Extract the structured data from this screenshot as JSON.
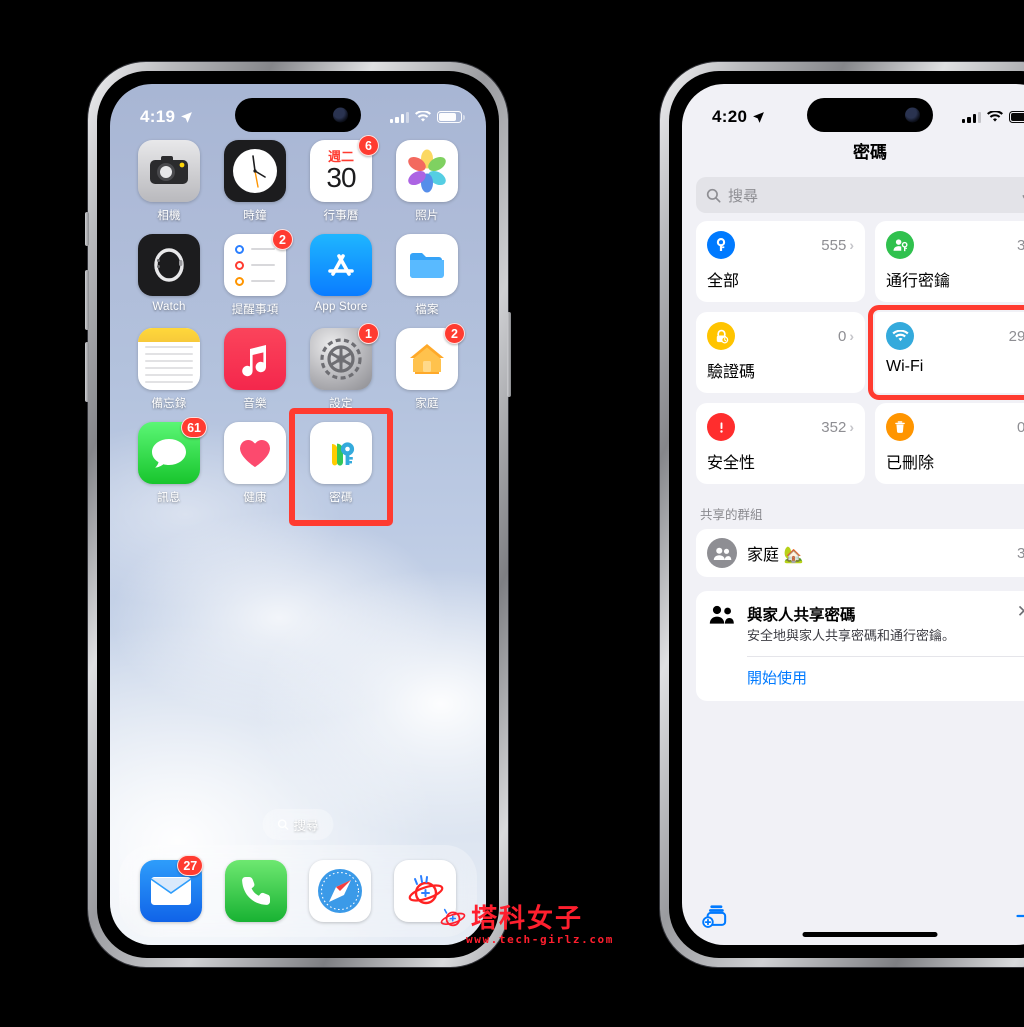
{
  "left_phone": {
    "status_bar": {
      "time": "4:19",
      "location_icon": "location-arrow-icon",
      "signal_icon": "cellular-signal-icon",
      "wifi_icon": "wifi-icon",
      "battery_icon": "battery-icon"
    },
    "home_rows": [
      [
        {
          "label": "相機",
          "icon": "camera-icon",
          "badge": ""
        },
        {
          "label": "時鐘",
          "icon": "clock-icon",
          "badge": ""
        },
        {
          "label": "行事曆",
          "icon": "calendar-icon",
          "badge": "6",
          "cal_dow": "週二",
          "cal_day": "30"
        },
        {
          "label": "照片",
          "icon": "photos-icon",
          "badge": ""
        }
      ],
      [
        {
          "label": "Watch",
          "icon": "watch-icon",
          "badge": ""
        },
        {
          "label": "提醒事項",
          "icon": "reminders-icon",
          "badge": "2"
        },
        {
          "label": "App Store",
          "icon": "app-store-icon",
          "badge": ""
        },
        {
          "label": "檔案",
          "icon": "files-icon",
          "badge": ""
        }
      ],
      [
        {
          "label": "備忘錄",
          "icon": "notes-icon",
          "badge": ""
        },
        {
          "label": "音樂",
          "icon": "music-icon",
          "badge": ""
        },
        {
          "label": "設定",
          "icon": "settings-icon",
          "badge": "1"
        },
        {
          "label": "家庭",
          "icon": "home-app-icon",
          "badge": "2"
        }
      ],
      [
        {
          "label": "訊息",
          "icon": "messages-icon",
          "badge": "61"
        },
        {
          "label": "健康",
          "icon": "health-icon",
          "badge": ""
        },
        {
          "label": "密碼",
          "icon": "passwords-icon",
          "badge": "",
          "highlighted": true
        },
        {
          "label": "",
          "icon": "",
          "badge": ""
        }
      ]
    ],
    "search_pill": {
      "label": "搜尋",
      "icon": "search-icon"
    },
    "dock": [
      {
        "label": "Mail",
        "icon": "mail-icon",
        "badge": "27"
      },
      {
        "label": "Phone",
        "icon": "phone-icon",
        "badge": ""
      },
      {
        "label": "Safari",
        "icon": "safari-icon",
        "badge": ""
      },
      {
        "label": "Planet",
        "icon": "planet-icon",
        "badge": ""
      }
    ]
  },
  "right_phone": {
    "status_bar": {
      "time": "4:20",
      "location_icon": "location-arrow-icon"
    },
    "title": "密碼",
    "search": {
      "placeholder": "搜尋",
      "icon": "search-icon",
      "mic_icon": "microphone-icon"
    },
    "categories": [
      {
        "label": "全部",
        "count": "555",
        "icon": "key-icon",
        "color": "#007aff",
        "highlighted": false
      },
      {
        "label": "通行密鑰",
        "count": "3",
        "icon": "passkey-icon",
        "color": "#30c14e",
        "highlighted": false
      },
      {
        "label": "驗證碼",
        "count": "0",
        "icon": "lock-clock-icon",
        "color": "#ffc400",
        "highlighted": false
      },
      {
        "label": "Wi-Fi",
        "count": "29",
        "icon": "wifi-icon",
        "color": "#34aadc",
        "highlighted": true
      },
      {
        "label": "安全性",
        "count": "352",
        "icon": "warning-icon",
        "color": "#ff2d2d",
        "highlighted": false
      },
      {
        "label": "已刪除",
        "count": "0",
        "icon": "trash-icon",
        "color": "#ff9500",
        "highlighted": false
      }
    ],
    "shared_groups": {
      "header": "共享的群組",
      "items": [
        {
          "name": "家庭 🏡",
          "count": "3",
          "icon": "people-icon"
        }
      ]
    },
    "banner": {
      "title": "與家人共享密碼",
      "subtitle": "安全地與家人共享密碼和通行密鑰。",
      "link": "開始使用",
      "icon": "family-icon",
      "close_icon": "close-icon"
    },
    "toolbar": {
      "new_group_icon": "new-shared-group-icon",
      "add_icon": "plus-icon"
    }
  },
  "watermark": {
    "name": "塔科女子",
    "url": "www.tech-girlz.com",
    "icon": "planet-logo-icon",
    "color": "#ff1f2e"
  }
}
